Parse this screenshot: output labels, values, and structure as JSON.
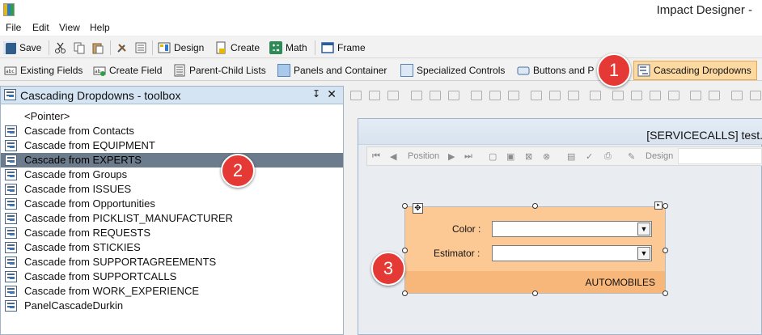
{
  "window": {
    "title": "Impact Designer -"
  },
  "menu": [
    "File",
    "Edit",
    "View",
    "Help"
  ],
  "toolbar": {
    "save": "Save",
    "design": "Design",
    "create": "Create",
    "math": "Math",
    "frame": "Frame"
  },
  "tabs": [
    {
      "label": "Existing Fields"
    },
    {
      "label": "Create Field"
    },
    {
      "label": "Parent-Child Lists"
    },
    {
      "label": "Panels and Container"
    },
    {
      "label": "Specialized Controls"
    },
    {
      "label": "Buttons and P"
    },
    {
      "label": "Cascading Dropdowns",
      "active": true
    }
  ],
  "toolbox": {
    "title": "Cascading Dropdowns - toolbox",
    "pin_glyph": "↧",
    "close_glyph": "✕",
    "items": [
      "<Pointer>",
      "Cascade from Contacts",
      "Cascade from EQUIPMENT",
      "Cascade from EXPERTS",
      "Cascade from Groups",
      "Cascade from ISSUES",
      "Cascade from Opportunities",
      "Cascade from PICKLIST_MANUFACTURER",
      "Cascade from REQUESTS",
      "Cascade from STICKIES",
      "Cascade from SUPPORTAGREEMENTS",
      "Cascade from SUPPORTCALLS",
      "Cascade from WORK_EXPERIENCE",
      "PanelCascadeDurkin"
    ],
    "selected_index": 3
  },
  "form": {
    "title": "[SERVICECALLS] test.",
    "nav": {
      "position": "Position",
      "design": "Design"
    },
    "panel": {
      "color_label": "Color :",
      "estimator_label": "Estimator :",
      "caption": "AUTOMOBILES",
      "color_value": "",
      "estimator_value": ""
    }
  },
  "callouts": [
    "1",
    "2",
    "3"
  ],
  "colors": {
    "accent_tab": "#fdd9a2",
    "panel": "#fcc894",
    "callout": "#e53935",
    "selection": "#6d7c8d"
  }
}
